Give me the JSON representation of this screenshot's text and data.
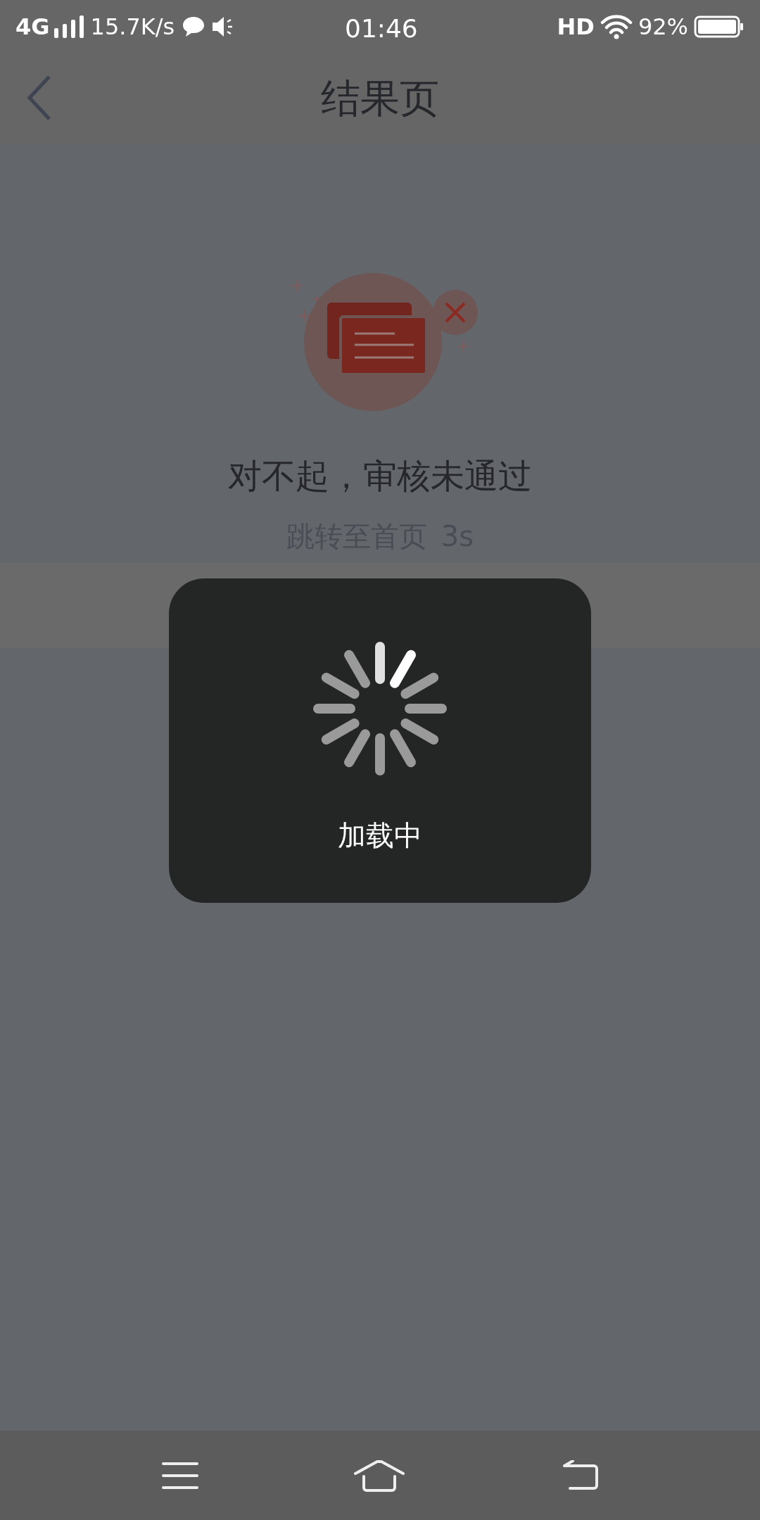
{
  "status_bar": {
    "network": "4G",
    "speed": "15.7K/s",
    "time": "01:46",
    "hd": "HD",
    "battery": "92%"
  },
  "header": {
    "title": "结果页"
  },
  "result": {
    "message": "对不起，审核未通过",
    "redirect": "跳转至首页",
    "countdown": "3s"
  },
  "loading": {
    "text": "加载中"
  }
}
